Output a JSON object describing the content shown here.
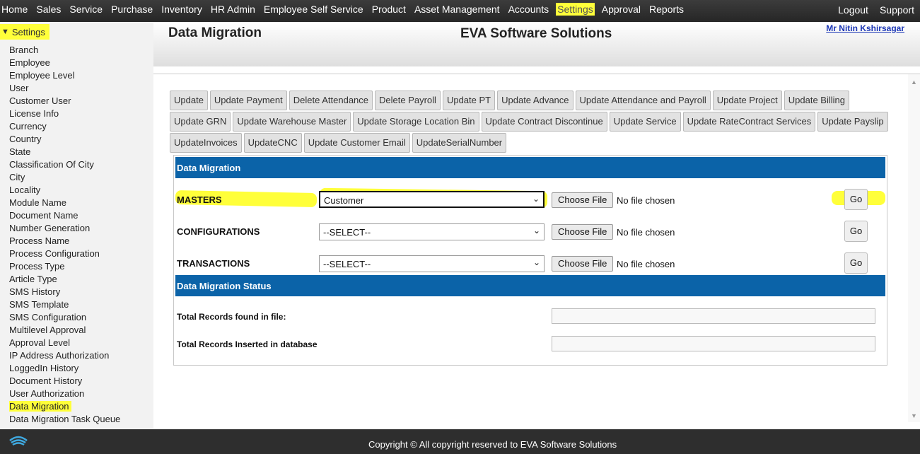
{
  "nav": {
    "items": [
      "Home",
      "Sales",
      "Service",
      "Purchase",
      "Inventory",
      "HR Admin",
      "Employee Self Service",
      "Product",
      "Asset Management",
      "Accounts",
      "Settings",
      "Approval",
      "Reports"
    ],
    "active": "Settings",
    "logout": "Logout",
    "support": "Support"
  },
  "sidebar": {
    "heading": "Settings",
    "items": [
      "Branch",
      "Employee",
      "Employee Level",
      "User",
      "Customer User",
      "License Info",
      "Currency",
      "Country",
      "State",
      "Classification Of City",
      "City",
      "Locality",
      "Module Name",
      "Document Name",
      "Number Generation",
      "Process Name",
      "Process Configuration",
      "Process Type",
      "Article Type",
      "SMS History",
      "SMS Template",
      "SMS Configuration",
      "Multilevel Approval",
      "Approval Level",
      "IP Address Authorization",
      "LoggedIn History",
      "Document History",
      "User Authorization",
      "Data Migration",
      "Data Migration Task Queue"
    ],
    "active": "Data Migration"
  },
  "header": {
    "page_title": "Data Migration",
    "company": "EVA Software Solutions",
    "user": "Mr Nitin Kshirsagar"
  },
  "buttons": {
    "row1": [
      "Update",
      "Update Payment",
      "Delete Attendance",
      "Delete Payroll",
      "Update PT",
      "Update Advance",
      "Update Attendance and Payroll",
      "Update Project",
      "Update Billing"
    ],
    "row2": [
      "Update GRN",
      "Update Warehouse Master",
      "Update Storage Location Bin",
      "Update Contract Discontinue",
      "Update Service",
      "Update RateContract Services",
      "Update Payslip"
    ],
    "row3": [
      "UpdateInvoices",
      "UpdateCNC",
      "Update Customer Email",
      "UpdateSerialNumber"
    ]
  },
  "migration": {
    "section_title": "Data Migration",
    "rows": [
      {
        "label": "MASTERS",
        "selected": "Customer",
        "file_button": "Choose File",
        "file_status": "No file chosen",
        "go": "Go"
      },
      {
        "label": "CONFIGURATIONS",
        "selected": "--SELECT--",
        "file_button": "Choose File",
        "file_status": "No file chosen",
        "go": "Go"
      },
      {
        "label": "TRANSACTIONS",
        "selected": "--SELECT--",
        "file_button": "Choose File",
        "file_status": "No file chosen",
        "go": "Go"
      }
    ],
    "status_title": "Data Migration Status",
    "status_rows": [
      {
        "label": "Total Records found in file:",
        "value": ""
      },
      {
        "label": "Total Records Inserted in database",
        "value": ""
      }
    ]
  },
  "footer": {
    "copyright": "Copyright © All copyright reserved to EVA Software Solutions"
  },
  "colors": {
    "highlight": "#ffff3a",
    "section_bar": "#0b63a8",
    "link": "#1a35b5"
  }
}
